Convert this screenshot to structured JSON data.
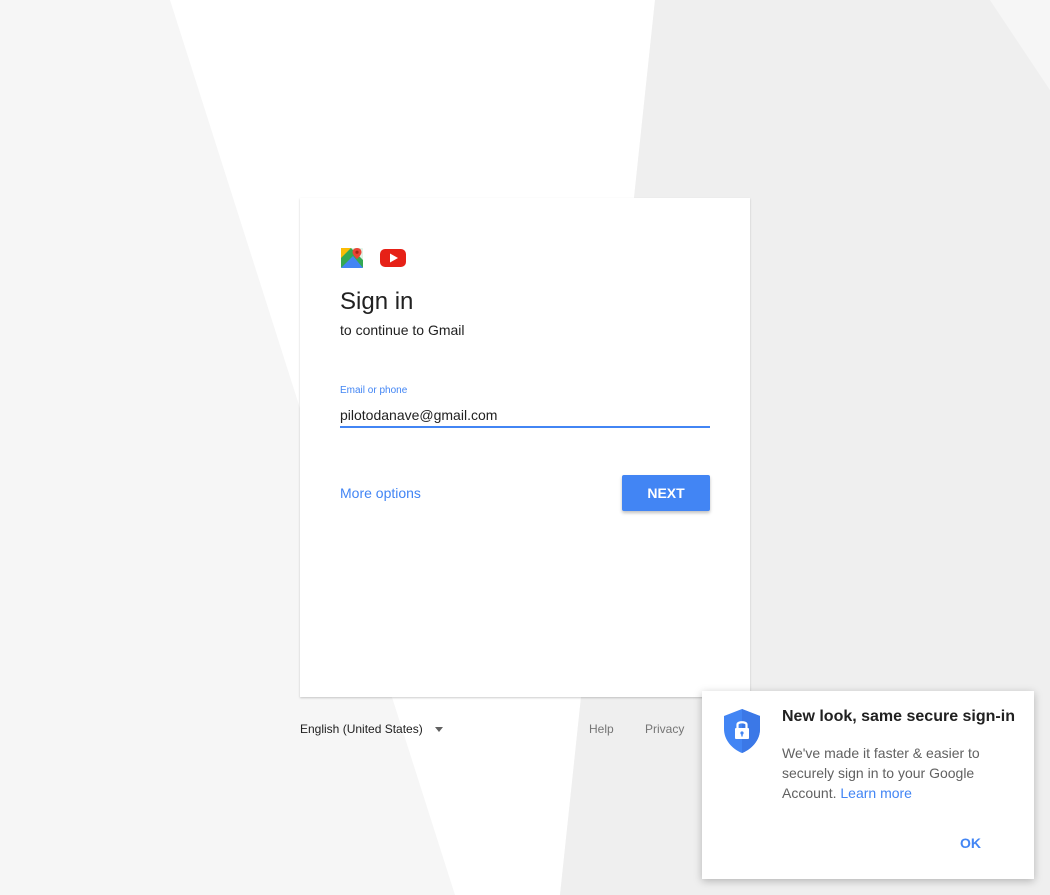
{
  "signin": {
    "title": "Sign in",
    "subtitle": "to continue to Gmail",
    "email_label": "Email or phone",
    "email_value": "pilotodanave@gmail.com",
    "more_options": "More options",
    "next": "NEXT"
  },
  "logos": [
    "maps-icon",
    "youtube-icon"
  ],
  "footer": {
    "language": "English (United States)",
    "help": "Help",
    "privacy": "Privacy"
  },
  "popup": {
    "icon": "shield-lock-icon",
    "title": "New look, same secure sign-in",
    "body": "We've made it faster & easier to securely sign in to your Google Account.",
    "learn_more": "Learn more",
    "ok": "OK"
  },
  "colors": {
    "accent": "#4285f4",
    "background": "#f5f5f5",
    "card": "#ffffff"
  }
}
